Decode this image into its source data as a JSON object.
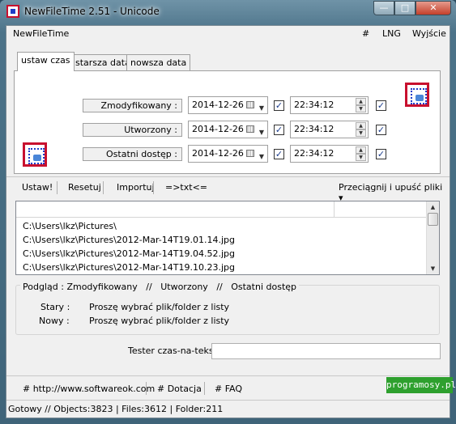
{
  "window": {
    "title": "NewFileTime 2.51 - Unicode",
    "min": "—",
    "max": "□",
    "close": "✕"
  },
  "menu": {
    "app": "NewFileTime",
    "hash": "#",
    "lng": "LNG",
    "exit": "Wyjście"
  },
  "tabs": [
    "ustaw czas",
    "starsza data",
    "nowsza data"
  ],
  "rows": [
    {
      "label": "Zmodyfikowany :",
      "date": "2014-12-26",
      "time": "22:34:12"
    },
    {
      "label": "Utworzony :",
      "date": "2014-12-26",
      "time": "22:34:12"
    },
    {
      "label": "Ostatni dostęp :",
      "date": "2014-12-26",
      "time": "22:34:12"
    }
  ],
  "checkmark": "✓",
  "toolbar": {
    "apply": "Ustaw!",
    "reset": "Resetuj",
    "import": "Importuj",
    "txt": "=>txt<=",
    "drag": "Przeciągnij i upuść pliki ▾"
  },
  "list": {
    "items": [
      "C:\\Users\\lkz\\Pictures\\",
      "C:\\Users\\lkz\\Pictures\\2012-Mar-14T19.01.14.jpg",
      "C:\\Users\\lkz\\Pictures\\2012-Mar-14T19.04.52.jpg",
      "C:\\Users\\lkz\\Pictures\\2012-Mar-14T19.10.23.jpg"
    ]
  },
  "preview": {
    "header": [
      "Podgląd",
      ":",
      "Zmodyfikowany",
      "//",
      "Utworzony",
      "//",
      "Ostatni dostęp"
    ],
    "old_label": "Stary :",
    "new_label": "Nowy :",
    "old_value": "Proszę wybrać plik/folder z listy",
    "new_value": "Proszę wybrać plik/folder z listy"
  },
  "tester": {
    "label": "Tester czas-na-tekst",
    "value": ""
  },
  "links": [
    "# http://www.softwareok.com",
    "# Dotacja",
    "# FAQ"
  ],
  "status": "Gotowy // Objects:3823 | Files:3612 | Folder:211",
  "watermark": "programosy.pl"
}
